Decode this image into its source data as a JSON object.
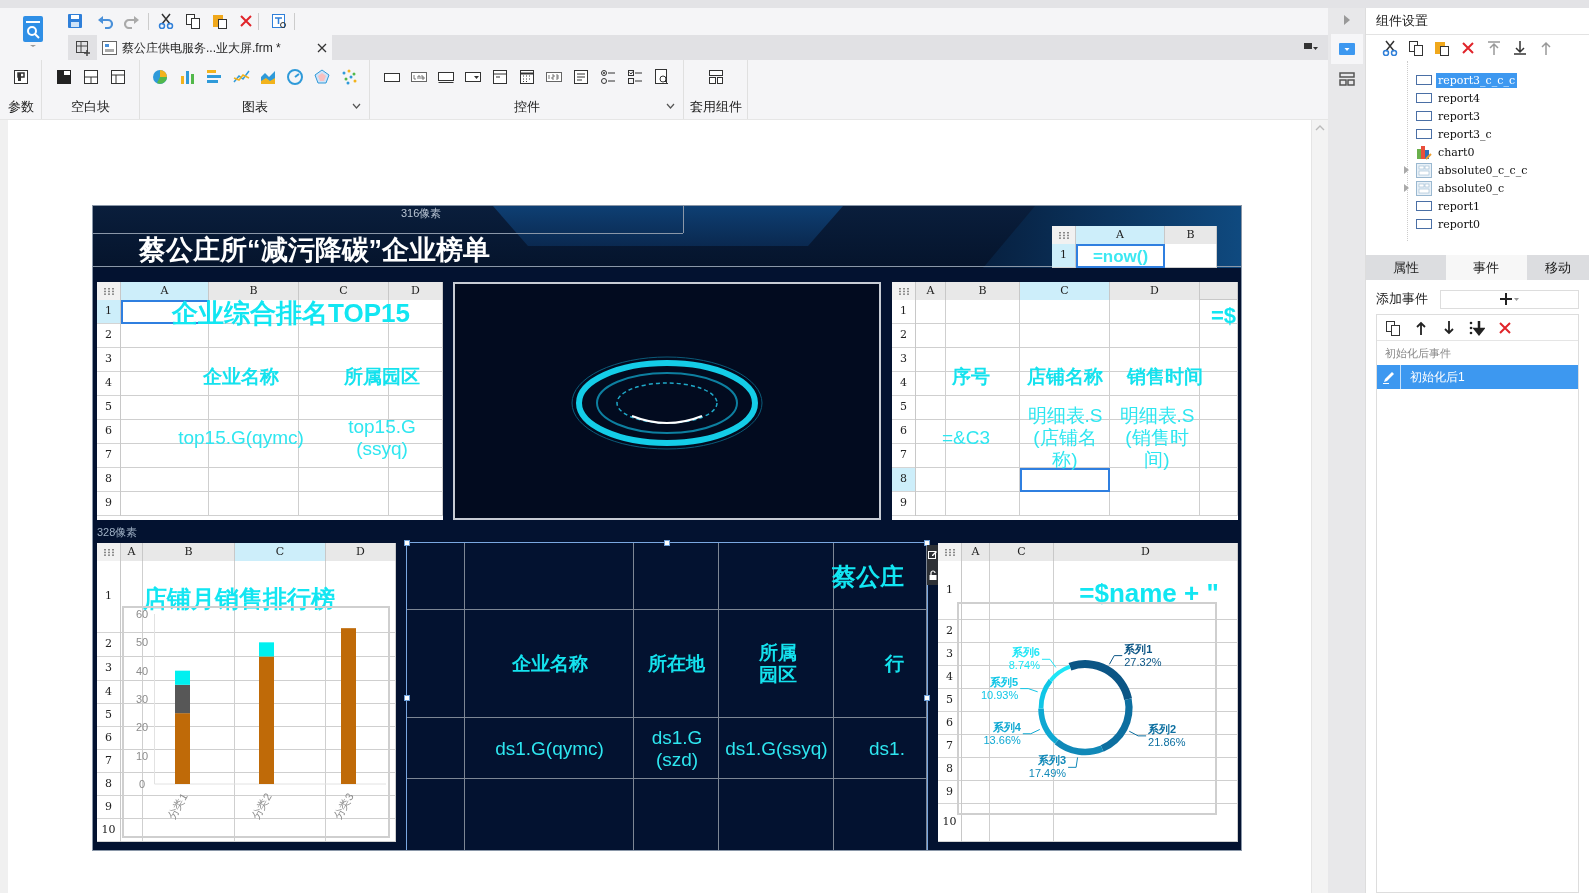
{
  "editor_tab": {
    "label": "蔡公庄供电服务...业大屏.frm *",
    "selected": true
  },
  "ribbon": [
    {
      "label": "参数",
      "dropdown": false
    },
    {
      "label": "空白块",
      "dropdown": false
    },
    {
      "label": "图表",
      "dropdown": true
    },
    {
      "label": "控件",
      "dropdown": true
    },
    {
      "label": "套用组件",
      "dropdown": false
    }
  ],
  "canvas": {
    "width_label": "316像素",
    "height_label": "328像素",
    "title": "蔡公庄所“减污降碳”企业榜单",
    "widgets": [
      {
        "kind": "report",
        "selected": false,
        "columns": [
          {
            "label": "A",
            "selected": true
          },
          {
            "label": "B",
            "selected": false
          }
        ],
        "rows": [
          {
            "label": "1",
            "selected": true
          }
        ],
        "cells": [
          {
            "text": "=now()",
            "kind": "formula"
          }
        ]
      },
      {
        "kind": "report",
        "selected": false,
        "columns": [
          {
            "label": "A",
            "selected": true
          },
          {
            "label": "B",
            "selected": false
          },
          {
            "label": "C",
            "selected": false
          },
          {
            "label": "D",
            "selected": false
          }
        ],
        "rows": [
          {
            "label": "1",
            "selected": true
          },
          {
            "label": "2",
            "selected": false
          },
          {
            "label": "3",
            "selected": false
          },
          {
            "label": "4",
            "selected": false
          },
          {
            "label": "5",
            "selected": false
          },
          {
            "label": "6",
            "selected": false
          },
          {
            "label": "7",
            "selected": false
          },
          {
            "label": "8",
            "selected": false
          },
          {
            "label": "9",
            "selected": false
          }
        ],
        "cells": [
          {
            "text": "企业综合排名TOP15",
            "kind": "title"
          },
          {
            "text": "企业名称",
            "kind": "header"
          },
          {
            "text": "所属园区",
            "kind": "header"
          },
          {
            "text": "top15.G(qymc)",
            "kind": "value"
          },
          {
            "text": "top15.G(ssyq)",
            "kind": "value"
          }
        ]
      },
      {
        "kind": "image",
        "selected": false
      },
      {
        "kind": "report",
        "selected": false,
        "columns": [
          {
            "label": "A",
            "selected": false
          },
          {
            "label": "B",
            "selected": false
          },
          {
            "label": "C",
            "selected": true
          },
          {
            "label": "D",
            "selected": false
          }
        ],
        "rows": [
          {
            "label": "1",
            "selected": false
          },
          {
            "label": "2",
            "selected": false
          },
          {
            "label": "3",
            "selected": false
          },
          {
            "label": "4",
            "selected": false
          },
          {
            "label": "5",
            "selected": false
          },
          {
            "label": "6",
            "selected": false
          },
          {
            "label": "7",
            "selected": false
          },
          {
            "label": "8",
            "selected": true
          },
          {
            "label": "9",
            "selected": false
          }
        ],
        "cells": [
          {
            "text": "=$",
            "kind": "title"
          },
          {
            "text": "序号",
            "kind": "header"
          },
          {
            "text": "店铺名称",
            "kind": "header"
          },
          {
            "text": "销售时间",
            "kind": "header"
          },
          {
            "text": "=&C3",
            "kind": "value"
          },
          {
            "text": "明细表.S(店铺名称)",
            "kind": "value"
          },
          {
            "text": "明细表.S(销售时间)",
            "kind": "value"
          }
        ]
      },
      {
        "kind": "report",
        "selected": false,
        "columns": [
          {
            "label": "A",
            "selected": false
          },
          {
            "label": "B",
            "selected": false
          },
          {
            "label": "C",
            "selected": true
          },
          {
            "label": "D",
            "selected": false
          }
        ],
        "rows": [
          {
            "label": "1",
            "selected": false
          },
          {
            "label": "2",
            "selected": false
          },
          {
            "label": "3",
            "selected": false
          },
          {
            "label": "4",
            "selected": false
          },
          {
            "label": "5",
            "selected": false
          },
          {
            "label": "6",
            "selected": false
          },
          {
            "label": "7",
            "selected": false
          },
          {
            "label": "8",
            "selected": false
          },
          {
            "label": "9",
            "selected": false
          },
          {
            "label": "10",
            "selected": false
          }
        ],
        "cells": [
          {
            "text": "店铺月销售排行榜",
            "kind": "title"
          }
        ],
        "chart_data": {
          "type": "bar",
          "stacked": true,
          "categories": [
            "分类1",
            "分类2",
            "分类3"
          ],
          "series": [
            {
              "color": "#bf6a08",
              "values": [
                25,
                45,
                55
              ]
            },
            {
              "color": "#575757",
              "values": [
                10,
                0,
                0
              ]
            },
            {
              "color": "#00f0f0",
              "values": [
                5,
                5,
                0
              ]
            }
          ],
          "ylim": [
            0,
            60
          ],
          "yticks": [
            0,
            10,
            20,
            30,
            40,
            50,
            60
          ]
        }
      },
      {
        "kind": "report",
        "selected": true,
        "cells": [
          {
            "text": "蔡公庄",
            "kind": "title"
          },
          {
            "text": "企业名称",
            "kind": "header"
          },
          {
            "text": "所在地",
            "kind": "header"
          },
          {
            "text": "所属园区",
            "kind": "header"
          },
          {
            "text": "行",
            "kind": "header"
          },
          {
            "text": "ds1.G(qymc)",
            "kind": "value"
          },
          {
            "text": "ds1.G(szd)",
            "kind": "value"
          },
          {
            "text": "ds1.G(ssyq)",
            "kind": "value"
          },
          {
            "text": "ds1.",
            "kind": "value"
          }
        ]
      },
      {
        "kind": "report",
        "selected": false,
        "columns": [
          {
            "label": "A",
            "selected": false
          },
          {
            "label": "C",
            "selected": false
          },
          {
            "label": "D",
            "selected": false
          }
        ],
        "rows": [
          {
            "label": "1",
            "selected": false
          },
          {
            "label": "2",
            "selected": false
          },
          {
            "label": "3",
            "selected": false
          },
          {
            "label": "4",
            "selected": false
          },
          {
            "label": "5",
            "selected": false
          },
          {
            "label": "6",
            "selected": false
          },
          {
            "label": "7",
            "selected": false
          },
          {
            "label": "8",
            "selected": false
          },
          {
            "label": "9",
            "selected": false
          },
          {
            "label": "10",
            "selected": false
          }
        ],
        "cells": [
          {
            "text": "=$name + \"",
            "kind": "title"
          }
        ],
        "chart_data": {
          "type": "donut",
          "categories": [
            "系列1",
            "系列2",
            "系列3",
            "系列4",
            "系列5",
            "系列6"
          ],
          "series": [
            {
              "values": [
                27.32,
                21.86,
                17.49,
                13.66,
                10.93,
                8.74
              ]
            }
          ],
          "colors": [
            "#0b5585",
            "#0d6fa0",
            "#1189b8",
            "#0fa8d2",
            "#10c6e6",
            "#1ee6f6"
          ],
          "value_labels": [
            "27.32%",
            "21.86%",
            "17.49%",
            "13.66%",
            "10.93%",
            "8.74%"
          ]
        }
      }
    ]
  },
  "panel": {
    "title": "组件设置",
    "tree": [
      {
        "label": "report3_c_c_c",
        "kind": "report",
        "selected": true
      },
      {
        "label": "report4",
        "kind": "report",
        "selected": false
      },
      {
        "label": "report3",
        "kind": "report",
        "selected": false
      },
      {
        "label": "report3_c",
        "kind": "report",
        "selected": false
      },
      {
        "label": "chart0",
        "kind": "chart",
        "selected": false
      },
      {
        "label": "absolute0_c_c_c",
        "kind": "container",
        "selected": false
      },
      {
        "label": "absolute0_c",
        "kind": "container",
        "selected": false
      },
      {
        "label": "report1",
        "kind": "report",
        "selected": false
      },
      {
        "label": "report0",
        "kind": "report",
        "selected": false
      }
    ],
    "tabs": [
      {
        "label": "属性",
        "selected": false
      },
      {
        "label": "事件",
        "selected": true
      },
      {
        "label": "移动",
        "selected": false
      }
    ],
    "add_event_label": "添加事件",
    "event_group": "初始化后事件",
    "events": [
      {
        "label": "初始化后1",
        "selected": true
      }
    ]
  }
}
